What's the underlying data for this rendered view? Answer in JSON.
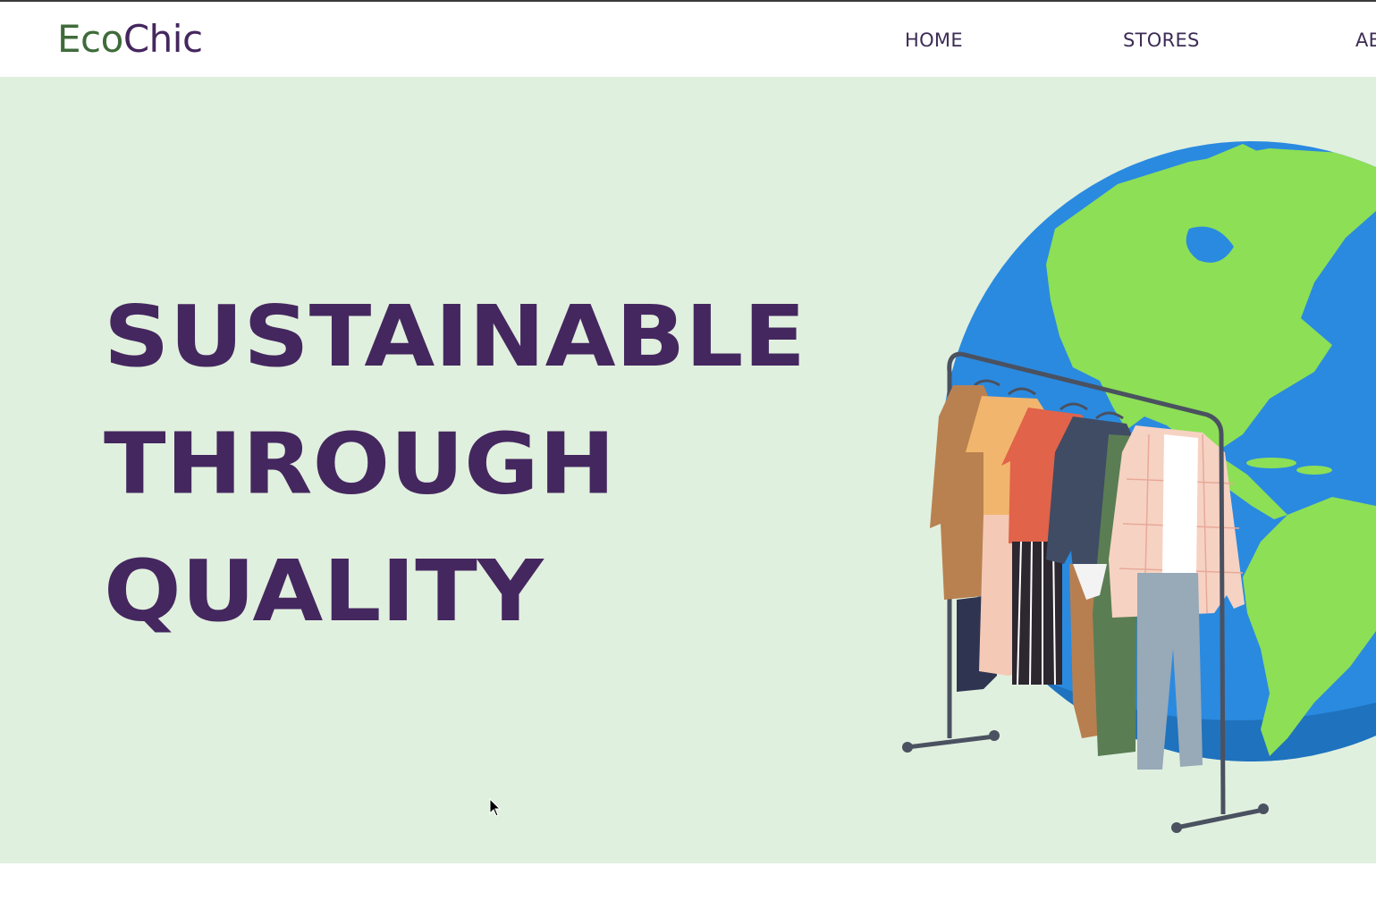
{
  "brand": {
    "name_part1": "Eco",
    "name_part2": "Chic",
    "color_part1": "#3f6b3a",
    "color_part2": "#45275f"
  },
  "nav": {
    "items": [
      {
        "label": "HOME"
      },
      {
        "label": "STORES"
      },
      {
        "label": "AB"
      }
    ]
  },
  "hero": {
    "lines": [
      "SUSTAINABLE",
      "THROUGH",
      "QUALITY"
    ],
    "heading_color": "#45275f",
    "background": "#e0f0de",
    "illustration": "globe-with-clothing-rack-illustration"
  },
  "colors": {
    "ocean": "#2a8ae0",
    "land": "#8ddf55",
    "rack": "#4a5160"
  }
}
